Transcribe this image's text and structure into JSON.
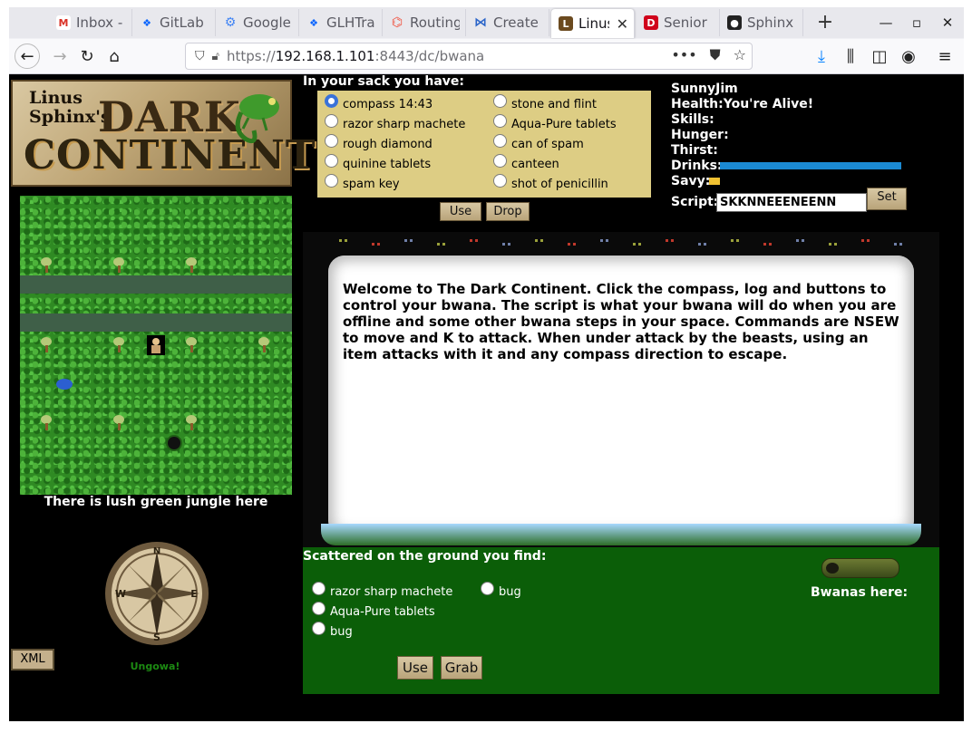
{
  "browser": {
    "tabs": [
      {
        "label": "Inbox -",
        "icon": "gmail-icon",
        "color": "#d93025"
      },
      {
        "label": "GitLab",
        "icon": "dropbox-icon",
        "color": "#0061fe"
      },
      {
        "label": "Google",
        "icon": "google-gear-icon",
        "color": "#4285f4"
      },
      {
        "label": "GLHTra",
        "icon": "dropbox-icon",
        "color": "#0061fe"
      },
      {
        "label": "Routing",
        "icon": "laravel-icon",
        "color": "#f05340"
      },
      {
        "label": "Create",
        "icon": "sourcetree-icon",
        "color": "#2b65c9"
      },
      {
        "label": "Linus",
        "icon": "linus-icon",
        "color": "#6b4a1f"
      },
      {
        "label": "Senior",
        "icon": "tumblr-icon",
        "color": "#d0021b"
      },
      {
        "label": "Sphinx",
        "icon": "github-icon",
        "color": "#222222"
      }
    ],
    "active_tab": 6,
    "url": {
      "scheme": "https://",
      "host": "192.168.1.101",
      "rest": ":8443/dc/bwana"
    },
    "url_menu": "•••"
  },
  "game": {
    "logo": {
      "line1": "Linus",
      "line2": "Sphinx's",
      "word1": "DARK",
      "word2": "CONTINENT"
    },
    "location_description": "There is lush green jungle here",
    "compass_letters": {
      "n": "N",
      "s": "S",
      "e": "E",
      "w": "W"
    },
    "xml_button": "XML",
    "ungowa": "Ungowa!",
    "sack": {
      "title": "In your sack you have:",
      "items": [
        "compass 14:43",
        "razor sharp machete",
        "rough diamond",
        "quinine tablets",
        "spam key",
        "stone and flint",
        "Aqua-Pure tablets",
        "can of spam",
        "canteen",
        "shot of penicillin"
      ],
      "selected": 0,
      "use_button": "Use",
      "drop_button": "Drop"
    },
    "status": {
      "name": "SunnyJim",
      "health_label": "Health:",
      "health_value": "You're Alive!",
      "skills_label": "Skills:",
      "hunger_label": "Hunger:",
      "thirst_label": "Thirst:",
      "drinks_label": "Drinks:",
      "drinks_level": 1.0,
      "savy_label": "Savy:",
      "savy_level": 0.06,
      "script_label": "Script:",
      "script_value": "SKKNNEEENEENN",
      "set_button": "Set"
    },
    "message": "Welcome to The Dark Continent. Click the compass, log and buttons to control your bwana. The script is what your bwana will do when you are offline and some other bwana steps in your space. Commands are NSEW to move and K to attack. When under attack by the beasts, using an item attacks with it and any compass direction to escape.",
    "ground": {
      "title": "Scattered on the ground you find:",
      "items": [
        "razor sharp machete",
        "bug",
        "Aqua-Pure tablets",
        "bug"
      ],
      "use_button": "Use",
      "grab_button": "Grab"
    },
    "bwanas_here": "Bwanas here:",
    "colors": {
      "sack_bg": "#ddcd84",
      "ground_bg": "#0b5e08",
      "drinks_bar": "#1b8ad3",
      "savy_bar": "#f1c232",
      "ungowa": "#1c8a12"
    }
  }
}
